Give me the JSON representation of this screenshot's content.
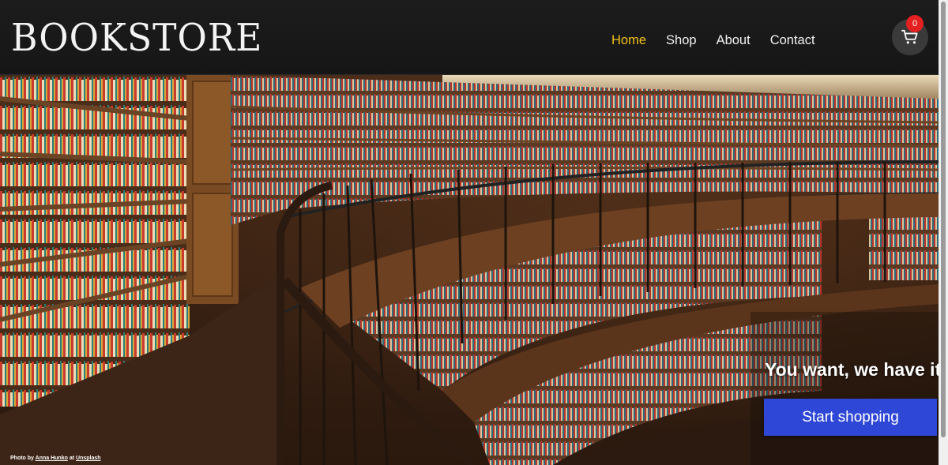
{
  "header": {
    "logo": "BOOKSTORE",
    "nav": [
      {
        "label": "Home",
        "active": true
      },
      {
        "label": "Shop",
        "active": false
      },
      {
        "label": "About",
        "active": false
      },
      {
        "label": "Contact",
        "active": false
      }
    ],
    "cart": {
      "icon": "cart-icon",
      "count": "0"
    }
  },
  "hero": {
    "tagline": "You want, we have it",
    "cta_label": "Start shopping",
    "credit": {
      "prefix": "Photo by ",
      "author": "Anna Hunko",
      "middle": " at ",
      "source": "Unsplash"
    }
  },
  "colors": {
    "header_bg": "#1a1a1a",
    "accent_active_nav": "#f2c21b",
    "cart_badge": "#e52020",
    "cta_bg": "#2f47d6"
  }
}
